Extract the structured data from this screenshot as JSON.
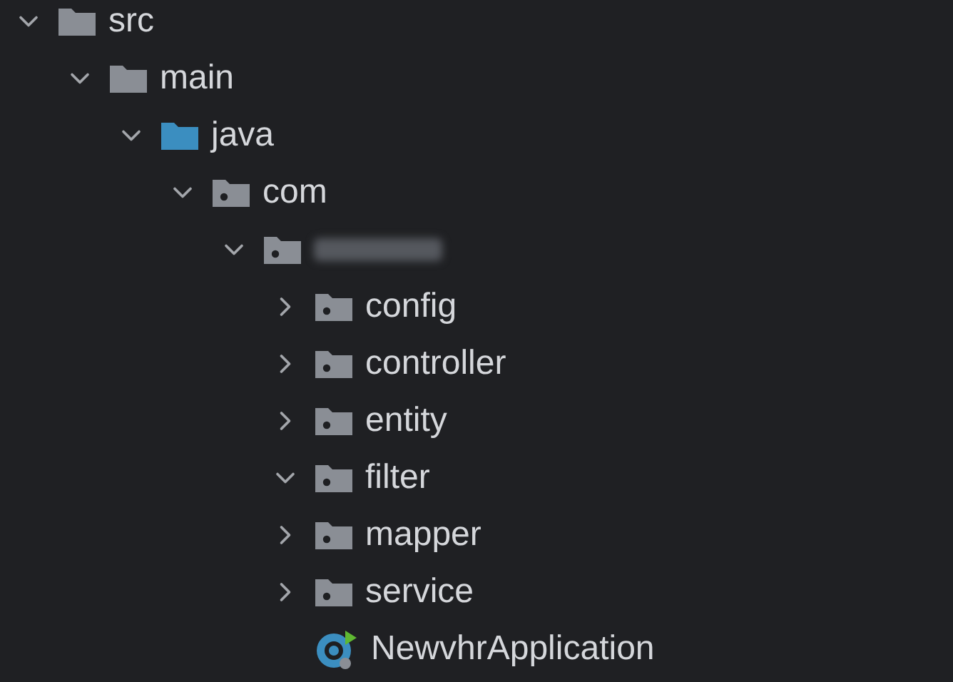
{
  "project_tree": [
    {
      "kind": "folder",
      "name": "src",
      "expanded": true,
      "children": [
        {
          "kind": "folder",
          "name": "main",
          "expanded": true,
          "children": [
            {
              "kind": "source-folder",
              "name": "java",
              "expanded": true,
              "children": [
                {
                  "kind": "package",
                  "name": "com",
                  "expanded": true,
                  "children": [
                    {
                      "kind": "package",
                      "redacted": true,
                      "expanded": true,
                      "children": [
                        {
                          "kind": "package",
                          "name": "config",
                          "expanded": false
                        },
                        {
                          "kind": "package",
                          "name": "controller",
                          "expanded": false
                        },
                        {
                          "kind": "package",
                          "name": "entity",
                          "expanded": false
                        },
                        {
                          "kind": "package",
                          "name": "filter",
                          "expanded": true
                        },
                        {
                          "kind": "package",
                          "name": "mapper",
                          "expanded": false
                        },
                        {
                          "kind": "package",
                          "name": "service",
                          "expanded": false
                        },
                        {
                          "kind": "app-class",
                          "name": "NewvhrApplication"
                        }
                      ]
                    }
                  ]
                }
              ]
            }
          ]
        }
      ]
    }
  ]
}
